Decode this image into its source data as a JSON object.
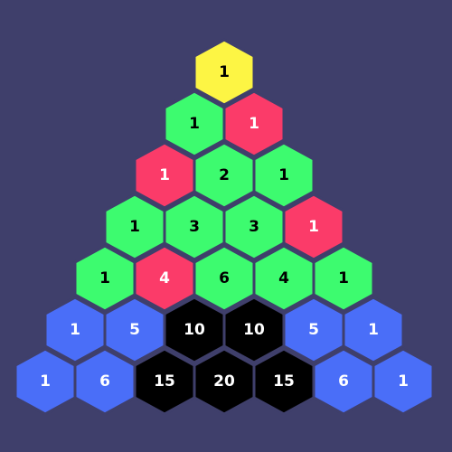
{
  "title": "",
  "palette": {
    "background": "#3f3f6b",
    "outline": "#3f3f6b",
    "yellow": "#fdf544",
    "green": "#3dfb6f",
    "red": "#fb3b69",
    "blue": "#4a6ef8",
    "black": "#000000",
    "dark_text": "#000000",
    "light_text": "#ffffff"
  },
  "rows": [
    [
      {
        "value": "1",
        "color": "yellow",
        "text": "dark_text"
      }
    ],
    [
      {
        "value": "1",
        "color": "green",
        "text": "dark_text"
      },
      {
        "value": "1",
        "color": "red",
        "text": "light_text"
      }
    ],
    [
      {
        "value": "1",
        "color": "red",
        "text": "light_text"
      },
      {
        "value": "2",
        "color": "green",
        "text": "dark_text"
      },
      {
        "value": "1",
        "color": "green",
        "text": "dark_text"
      }
    ],
    [
      {
        "value": "1",
        "color": "green",
        "text": "dark_text"
      },
      {
        "value": "3",
        "color": "green",
        "text": "dark_text"
      },
      {
        "value": "3",
        "color": "green",
        "text": "dark_text"
      },
      {
        "value": "1",
        "color": "red",
        "text": "light_text"
      }
    ],
    [
      {
        "value": "1",
        "color": "green",
        "text": "dark_text"
      },
      {
        "value": "4",
        "color": "red",
        "text": "light_text"
      },
      {
        "value": "6",
        "color": "green",
        "text": "dark_text"
      },
      {
        "value": "4",
        "color": "green",
        "text": "dark_text"
      },
      {
        "value": "1",
        "color": "green",
        "text": "dark_text"
      }
    ],
    [
      {
        "value": "1",
        "color": "blue",
        "text": "light_text"
      },
      {
        "value": "5",
        "color": "blue",
        "text": "light_text"
      },
      {
        "value": "10",
        "color": "black",
        "text": "light_text"
      },
      {
        "value": "10",
        "color": "black",
        "text": "light_text"
      },
      {
        "value": "5",
        "color": "blue",
        "text": "light_text"
      },
      {
        "value": "1",
        "color": "blue",
        "text": "light_text"
      }
    ],
    [
      {
        "value": "1",
        "color": "blue",
        "text": "light_text"
      },
      {
        "value": "6",
        "color": "blue",
        "text": "light_text"
      },
      {
        "value": "15",
        "color": "black",
        "text": "light_text"
      },
      {
        "value": "20",
        "color": "black",
        "text": "light_text"
      },
      {
        "value": "15",
        "color": "black",
        "text": "light_text"
      },
      {
        "value": "6",
        "color": "blue",
        "text": "light_text"
      },
      {
        "value": "1",
        "color": "blue",
        "text": "light_text"
      }
    ]
  ]
}
